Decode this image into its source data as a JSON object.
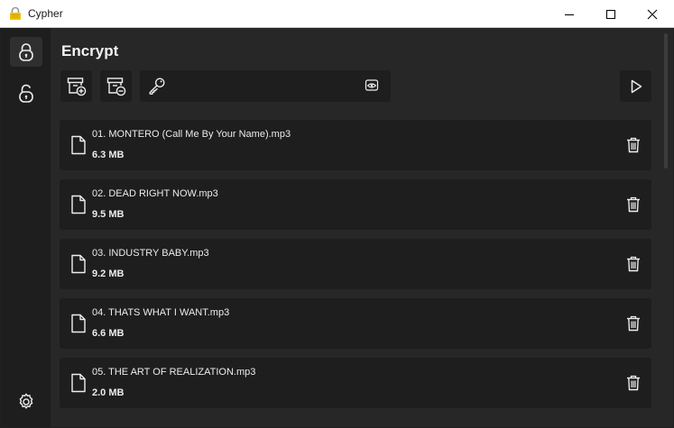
{
  "window": {
    "title": "Cypher",
    "icon": "padlock-icon",
    "controls": [
      "minimize-icon",
      "maximize-icon",
      "close-icon"
    ]
  },
  "sidebar": {
    "items": [
      {
        "name": "encrypt",
        "icon": "lock-icon",
        "active": true
      },
      {
        "name": "decrypt",
        "icon": "unlock-icon",
        "active": false
      },
      {
        "name": "settings",
        "icon": "gear-icon",
        "active": false
      }
    ]
  },
  "page": {
    "title": "Encrypt"
  },
  "toolbar": {
    "add_icon": "archive-add-icon",
    "remove_icon": "archive-remove-icon",
    "key_icon": "key-icon",
    "key_value": "",
    "reveal_icon": "reveal-password-icon",
    "run_icon": "play-icon"
  },
  "files": [
    {
      "name": "01. MONTERO (Call Me By Your Name).mp3",
      "size": "6.3 MB"
    },
    {
      "name": "02. DEAD RIGHT NOW.mp3",
      "size": "9.5 MB"
    },
    {
      "name": "03. INDUSTRY BABY.mp3",
      "size": "9.2 MB"
    },
    {
      "name": "04. THATS WHAT I WANT.mp3",
      "size": "6.6 MB"
    },
    {
      "name": "05. THE ART OF REALIZATION.mp3",
      "size": "2.0 MB"
    }
  ],
  "colors": {
    "background": "#202020",
    "panel": "#272727",
    "card": "#1e1e1e",
    "accent_icon": "#f2c200",
    "text": "#ffffff"
  }
}
